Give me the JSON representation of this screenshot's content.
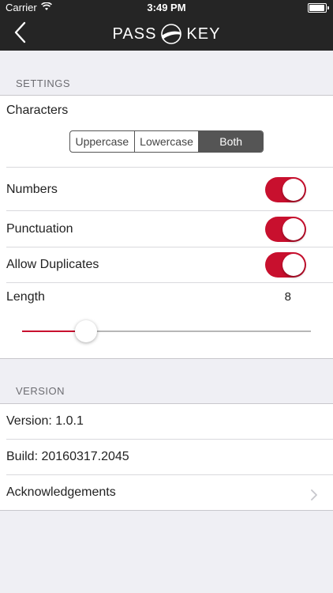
{
  "status_bar": {
    "carrier": "Carrier",
    "time": "3:49 PM"
  },
  "nav": {
    "logo_left": "PASS",
    "logo_right": "KEY"
  },
  "settings": {
    "section_title": "SETTINGS",
    "characters_label": "Characters",
    "segments": [
      {
        "label": "Uppercase",
        "selected": false
      },
      {
        "label": "Lowercase",
        "selected": false
      },
      {
        "label": "Both",
        "selected": true
      }
    ],
    "numbers_label": "Numbers",
    "numbers_on": true,
    "punctuation_label": "Punctuation",
    "punctuation_on": true,
    "duplicates_label": "Allow Duplicates",
    "duplicates_on": true,
    "length_label": "Length",
    "length_value": "8",
    "length_fraction": 0.22
  },
  "version": {
    "section_title": "VERSION",
    "version_text": "Version: 1.0.1",
    "build_text": "Build: 20160317.2045",
    "acknowledgements_label": "Acknowledgements"
  },
  "colors": {
    "accent": "#c8102e",
    "nav_bg": "#252525"
  }
}
